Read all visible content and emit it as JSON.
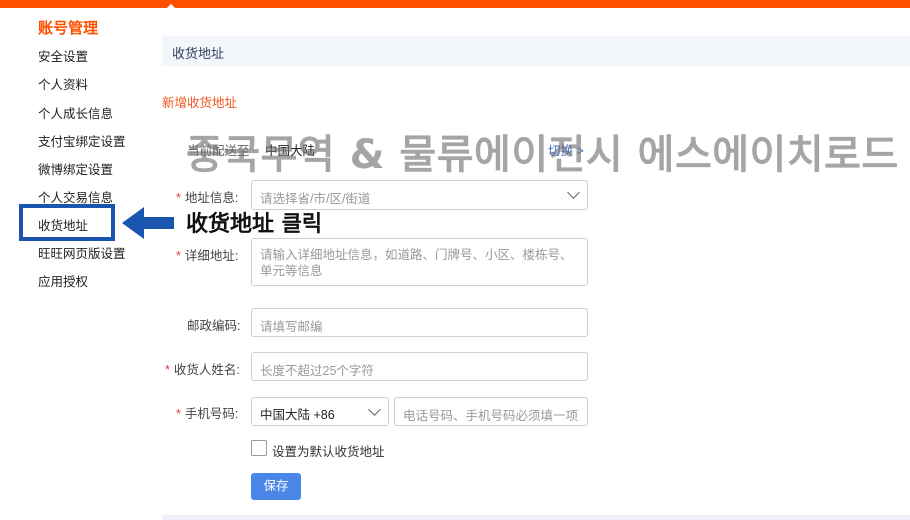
{
  "sidebar": {
    "title": "账号管理",
    "items": [
      {
        "label": "安全设置"
      },
      {
        "label": "个人资料"
      },
      {
        "label": "个人成长信息"
      },
      {
        "label": "支付宝绑定设置"
      },
      {
        "label": "微博绑定设置"
      },
      {
        "label": "个人交易信息"
      },
      {
        "label": "收货地址"
      },
      {
        "label": "旺旺网页版设置"
      },
      {
        "label": "应用授权"
      }
    ],
    "highlight_color": "#1a56b0"
  },
  "annotation": {
    "callout": "收货地址 클릭",
    "watermark": "중국무역 & 물류에이전시 에스에이치로드"
  },
  "header": {
    "section_title": "收货地址",
    "accent_color": "#ff5000"
  },
  "form": {
    "title": "新增收货地址",
    "deliver_label": "当前配送至",
    "deliver_value": "中国大陆",
    "switch_label": "切换 >",
    "address": {
      "label": "地址信息:",
      "placeholder": "请选择省/市/区/街道"
    },
    "detail": {
      "label": "详细地址:",
      "placeholder": "请输入详细地址信息，如道路、门牌号、小区、楼栋号、单元等信息"
    },
    "postcode": {
      "label": "邮政编码:",
      "placeholder": "请填写邮编"
    },
    "name": {
      "label": "收货人姓名:",
      "placeholder": "长度不超过25个字符"
    },
    "phone": {
      "label": "手机号码:",
      "country": "中国大陆 +86",
      "placeholder": "电话号码、手机号码必须填一项"
    },
    "required_mark": "*",
    "default_checkbox_label": "设置为默认收货地址",
    "save_label": "保存",
    "button_color": "#4a86e8"
  }
}
